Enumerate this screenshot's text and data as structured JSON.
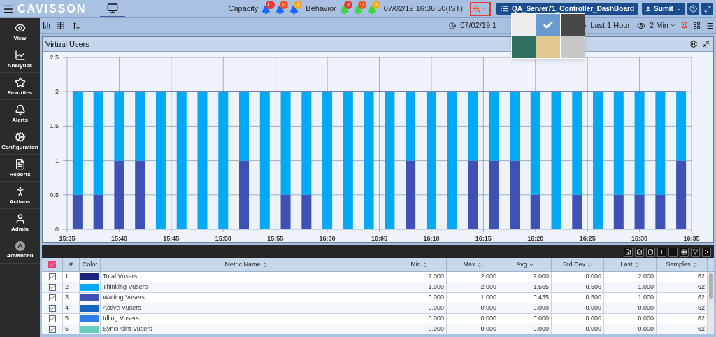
{
  "header": {
    "logo": "CAVISSON",
    "capacity": {
      "label": "Capacity",
      "alerts": [
        {
          "count": "10",
          "color": "#e53935"
        },
        {
          "count": "0",
          "color": "#f4511e"
        },
        {
          "count": "1",
          "color": "#f9a825"
        }
      ]
    },
    "behavior": {
      "label": "Behavior",
      "alerts": [
        {
          "count": "3",
          "color": "#e53935"
        },
        {
          "count": "0",
          "color": "#f4511e"
        },
        {
          "count": "3",
          "color": "#f9a825"
        }
      ]
    },
    "datetime": "07/02/19 16:36:50(IST)",
    "dashboard": "QA_Server71_Controller_DashBoard",
    "user": "Sumit"
  },
  "theme_picker": {
    "swatches": [
      {
        "color": "#ececec",
        "selected": false
      },
      {
        "color": "#6a9bd0",
        "selected": true
      },
      {
        "color": "#484848",
        "selected": false
      },
      {
        "color": "#2e7060",
        "selected": false
      },
      {
        "color": "#e2c98f",
        "selected": false
      },
      {
        "color": "#c8c8c8",
        "selected": false
      }
    ]
  },
  "toolbar": {
    "time_start": "07/02/19 1",
    "range": "Last 1 Hour",
    "interval": "2 Min"
  },
  "sidebar": {
    "items": [
      {
        "label": "View",
        "kind": "eye"
      },
      {
        "label": "Analytics",
        "kind": "chart"
      },
      {
        "label": "Favorites",
        "kind": "star"
      },
      {
        "label": "Alerts",
        "kind": "bell"
      },
      {
        "label": "Configuration",
        "kind": "cogs"
      },
      {
        "label": "Reports",
        "kind": "file"
      },
      {
        "label": "Actions",
        "kind": "person"
      },
      {
        "label": "Admin",
        "kind": "user"
      },
      {
        "label": "Advanced",
        "kind": "advanced"
      }
    ]
  },
  "panel": {
    "title": "Virtual Users",
    "chart_data": {
      "type": "bar",
      "stacked": true,
      "grid": true,
      "categories": [
        "15:35",
        null,
        null,
        null,
        null,
        "15:40",
        null,
        null,
        null,
        null,
        "15:45",
        null,
        null,
        null,
        null,
        "15:50",
        null,
        null,
        null,
        null,
        "15:55",
        null,
        null,
        null,
        null,
        "16:00",
        null,
        null,
        null,
        null,
        "16:05",
        null,
        null,
        null,
        null,
        "16:10",
        null,
        null,
        null,
        null,
        "16:15",
        null,
        null,
        null,
        null,
        "16:20",
        null,
        null,
        null,
        null,
        "16:25",
        null,
        null,
        null,
        null,
        "16:30",
        null,
        null,
        null,
        null,
        "16:35"
      ],
      "series": [
        {
          "color": "#3f51b5",
          "values": [
            null,
            0.5,
            null,
            0.5,
            null,
            1,
            null,
            1,
            null,
            0,
            null,
            0,
            null,
            0,
            null,
            0,
            null,
            1,
            null,
            0,
            null,
            0.5,
            null,
            0.5,
            null,
            0,
            null,
            0,
            null,
            0,
            null,
            0,
            null,
            1,
            null,
            0,
            null,
            0,
            null,
            1,
            null,
            1,
            null,
            1,
            null,
            0.5,
            null,
            0,
            null,
            0.5,
            null,
            0,
            null,
            0.5,
            null,
            0.5,
            null,
            0.5,
            null,
            1,
            null
          ]
        },
        {
          "color": "#03a9f4",
          "values": [
            null,
            1.5,
            null,
            1.5,
            null,
            1,
            null,
            1,
            null,
            2,
            null,
            2,
            null,
            2,
            null,
            2,
            null,
            1,
            null,
            2,
            null,
            1.5,
            null,
            1.5,
            null,
            2,
            null,
            2,
            null,
            2,
            null,
            2,
            null,
            1,
            null,
            2,
            null,
            2,
            null,
            1,
            null,
            1,
            null,
            1,
            null,
            1.5,
            null,
            2,
            null,
            1.5,
            null,
            2,
            null,
            1.5,
            null,
            1.5,
            null,
            1.5,
            null,
            1,
            null
          ]
        }
      ],
      "ylim": [
        0,
        2.5
      ],
      "yticks": [
        0,
        0.5,
        1,
        1.5,
        2,
        2.5
      ]
    }
  },
  "table": {
    "select_all": {
      "checked": true
    },
    "columns": [
      {
        "label": "#",
        "sorted": false,
        "sortable": false
      },
      {
        "label": "Color",
        "sorted": false,
        "sortable": false
      },
      {
        "label": "Metric Name",
        "sorted": false,
        "sortable": true
      },
      {
        "label": "Min",
        "sorted": false,
        "sortable": true
      },
      {
        "label": "Max",
        "sorted": false,
        "sortable": true
      },
      {
        "label": "Avg",
        "sorted": true,
        "sortable": true
      },
      {
        "label": "Std Dev",
        "sorted": false,
        "sortable": true
      },
      {
        "label": "Last",
        "sorted": false,
        "sortable": true
      },
      {
        "label": "Samples",
        "sorted": false,
        "sortable": true
      }
    ],
    "rows": [
      {
        "checked": true,
        "index": "1",
        "color": "#1a237e",
        "metric": "Total Vusers",
        "min": "2.000",
        "max": "2.000",
        "avg": "2.000",
        "std_dev": "0.000",
        "last": "2.000",
        "samples": "62"
      },
      {
        "checked": true,
        "index": "2",
        "color": "#03a9f4",
        "metric": "Thinking Vusers",
        "min": "1.000",
        "max": "2.000",
        "avg": "1.565",
        "std_dev": "0.500",
        "last": "1.000",
        "samples": "62"
      },
      {
        "checked": true,
        "index": "3",
        "color": "#3f51b5",
        "metric": "Waiting Vusers",
        "min": "0.000",
        "max": "1.000",
        "avg": "0.435",
        "std_dev": "0.500",
        "last": "1.000",
        "samples": "62"
      },
      {
        "checked": true,
        "index": "4",
        "color": "#1565c0",
        "metric": "Active Vusers",
        "min": "0.000",
        "max": "0.000",
        "avg": "0.000",
        "std_dev": "0.000",
        "last": "0.000",
        "samples": "62"
      },
      {
        "checked": true,
        "index": "5",
        "color": "#2f7be8",
        "metric": "Idling Vusers",
        "min": "0.000",
        "max": "0.000",
        "avg": "0.000",
        "std_dev": "0.000",
        "last": "0.000",
        "samples": "62"
      },
      {
        "checked": true,
        "index": "6",
        "color": "#66cdbf",
        "metric": "SyncPoint Vusers",
        "min": "0.000",
        "max": "0.000",
        "avg": "0.000",
        "std_dev": "0.000",
        "last": "0.000",
        "samples": "62"
      }
    ]
  }
}
